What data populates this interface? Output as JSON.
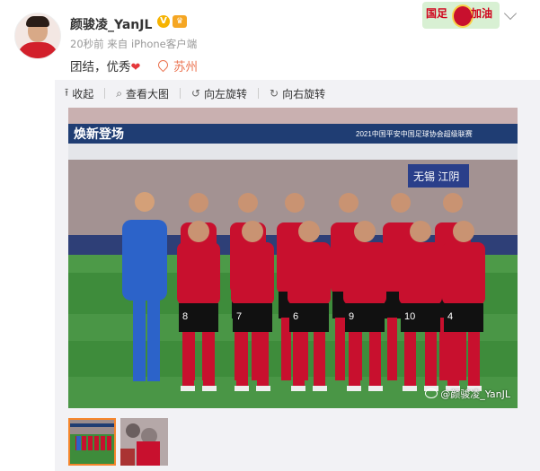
{
  "post": {
    "author": "颜骏凌_YanJL",
    "verified_icon": "verified-badge-icon",
    "member_icon": "vip-member-icon",
    "meta": "20秒前 来自 iPhone客户端",
    "text": "团结，优秀",
    "emoji": "❤",
    "location": "苏州",
    "fan_badge": {
      "left": "国足",
      "right": "加油"
    }
  },
  "toolbar": {
    "collapse": "收起",
    "view_large": "查看大图",
    "rotate_left": "向左旋转",
    "rotate_right": "向右旋转"
  },
  "photo": {
    "watermark": "@颜骏凌_YanJL",
    "banner_left": "焕新登场",
    "banner_right": "2021中国平安中国足球协会超级联赛",
    "sign": "无锡 江阴",
    "jerseys": [
      "8",
      "7",
      "6",
      "9",
      "10",
      "4"
    ]
  },
  "thumbnails": [
    {
      "label": "team-photo"
    },
    {
      "label": "crowd-photo"
    }
  ],
  "colors": {
    "accent": "#eb7350",
    "kit_red": "#c8102e",
    "keeper_blue": "#2c63c9"
  }
}
